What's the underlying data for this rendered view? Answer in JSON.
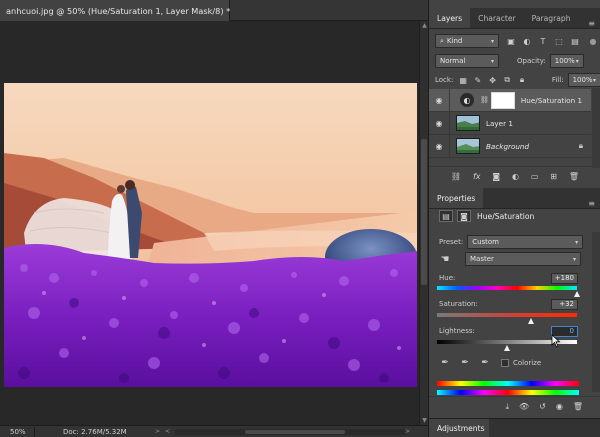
{
  "document": {
    "tab_title": "anhcuoi.jpg @ 50% (Hue/Saturation 1, Layer Mask/8) *",
    "close_glyph": "×",
    "zoom": "50%",
    "doc_size": "Doc: 2.76M/5.32M"
  },
  "layers_panel": {
    "tabs": [
      "Layers",
      "Character",
      "Paragraph"
    ],
    "active_tab": "Layers",
    "filter_kind": "Kind",
    "blend_mode": "Normal",
    "opacity_label": "Opacity:",
    "opacity_value": "100%",
    "lock_label": "Lock:",
    "fill_label": "Fill:",
    "fill_value": "100%",
    "layers": [
      {
        "name": "Hue/Saturation 1",
        "visible": true,
        "selected": true,
        "italic": false
      },
      {
        "name": "Layer 1",
        "visible": true,
        "selected": false,
        "italic": false
      },
      {
        "name": "Background",
        "visible": true,
        "selected": false,
        "italic": true
      }
    ]
  },
  "properties_panel": {
    "tab": "Properties",
    "adjustment_name": "Hue/Saturation",
    "preset_label": "Preset:",
    "preset_value": "Custom",
    "channel_value": "Master",
    "hue_label": "Hue:",
    "hue_value": "+180",
    "saturation_label": "Saturation:",
    "saturation_value": "+32",
    "lightness_label": "Lightness:",
    "lightness_value": "0",
    "colorize_label": "Colorize"
  },
  "adjustments_tab": "Adjustments",
  "colors": {
    "accent_focus": "#3d86d6",
    "panel_bg": "#434343",
    "selected_layer": "#5b5b5b"
  }
}
